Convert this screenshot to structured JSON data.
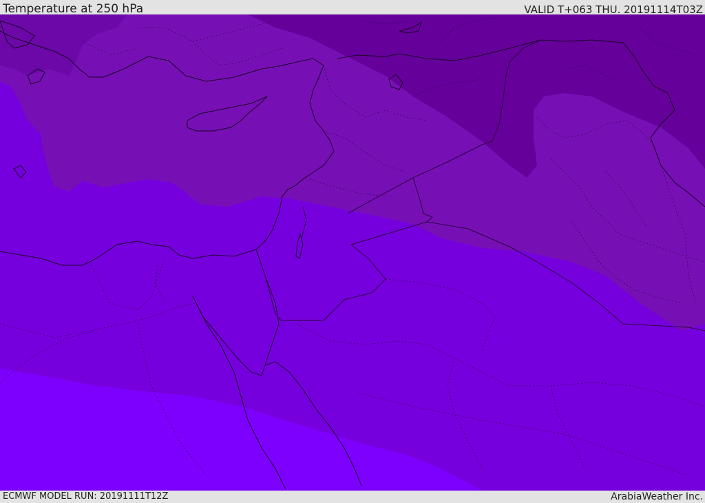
{
  "header": {
    "title": "Temperature at 250 hPa",
    "valid": "VALID T+063 THU. 20191114T03Z"
  },
  "footer": {
    "model_run": "ECMWF MODEL RUN: 20191111T12Z",
    "credit": "ArabiaWeather Inc."
  },
  "map": {
    "colors": {
      "band_coldest": "#65009a",
      "band_cold": "#7710b4",
      "band_mid": "#7600dd",
      "band_warm": "#7d00ff",
      "coastline": "#1a0028",
      "border": "#2a0040"
    }
  }
}
